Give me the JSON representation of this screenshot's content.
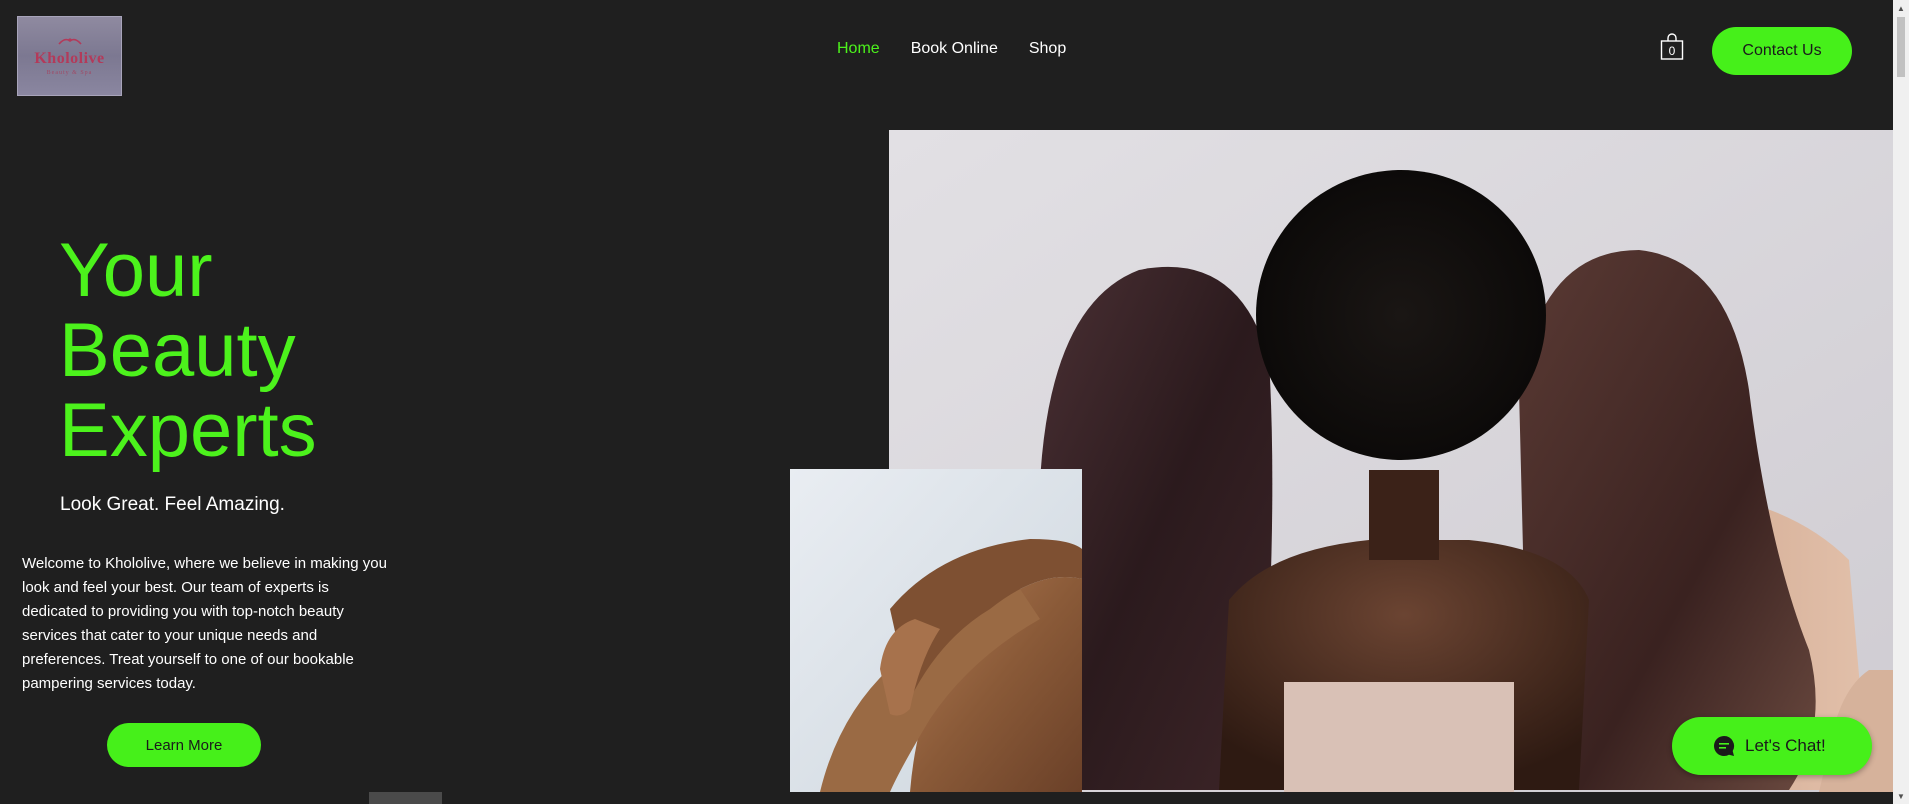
{
  "header": {
    "logo": {
      "name": "Khololive",
      "tagline": "Beauty & Spa"
    },
    "nav": [
      {
        "label": "Home",
        "active": true
      },
      {
        "label": "Book Online",
        "active": false
      },
      {
        "label": "Shop",
        "active": false
      }
    ],
    "cart_count": "0",
    "contact_label": "Contact Us"
  },
  "hero": {
    "title_lines": [
      "Your",
      "Beauty",
      "Experts"
    ],
    "subtitle": "Look Great. Feel Amazing.",
    "intro": "Welcome to Khololive, where we believe in making you look and feel your best. Our team of experts is dedicated to providing you with top-notch beauty services that cater to your unique needs and preferences. Treat yourself to one of our bookable pampering services today.",
    "cta_label": "Learn More"
  },
  "chat": {
    "label": "Let's Chat!"
  },
  "colors": {
    "accent": "#46f01a",
    "background": "#1f1f1f",
    "text": "#ffffff"
  }
}
